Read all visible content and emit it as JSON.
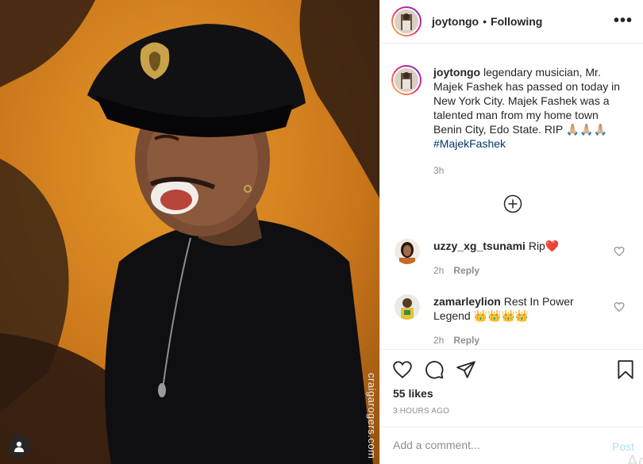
{
  "photo": {
    "watermark": "craigarogers.com",
    "alt_description": "portrait photo"
  },
  "header": {
    "username": "joytongo",
    "separator": "•",
    "following_label": "Following",
    "more_label": "•••"
  },
  "caption": {
    "username": "joytongo",
    "text": "legendary musician, Mr. Majek Fashek has passed on today in New York City. Majek Fashek was a talented man from my home town Benin City, Edo State. RIP 🙏🏼🙏🏼🙏🏼",
    "hashtag": "#MajekFashek",
    "time": "3h"
  },
  "comments": [
    {
      "username": "uzzy_xg_tsunami",
      "text": "Rip❤️",
      "time": "2h",
      "reply_label": "Reply"
    },
    {
      "username": "zamarleylion",
      "text": "Rest In Power Legend 👑👑👑👑",
      "time": "2h",
      "reply_label": "Reply"
    }
  ],
  "actions": {
    "likes": "55 likes",
    "timeago": "3 HOURS AGO"
  },
  "add_comment": {
    "placeholder": "Add a comment...",
    "post_label": "Post",
    "overlay_text": "Ac"
  },
  "colors": {
    "text": "#262626",
    "secondary": "#8e8e8e",
    "link": "#00376b",
    "post_disabled": "#b2dffc",
    "border": "#efefef"
  }
}
